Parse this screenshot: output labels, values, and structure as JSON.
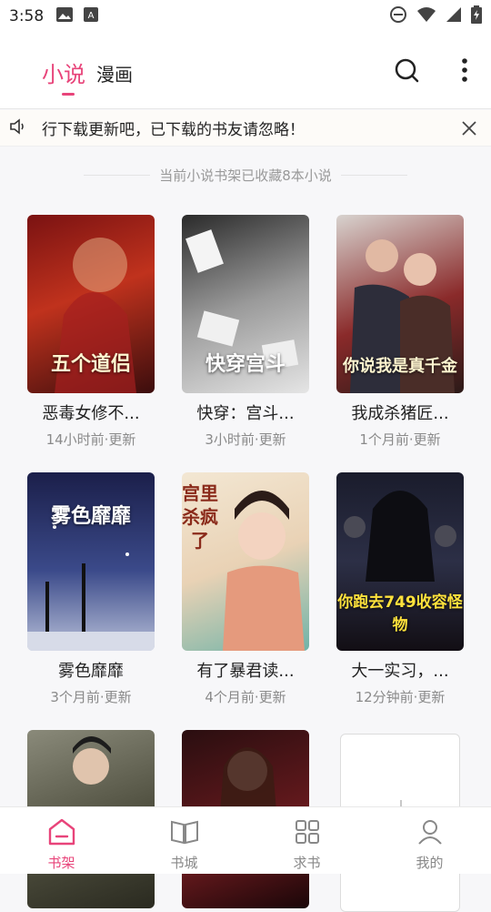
{
  "status_bar": {
    "time": "3:58"
  },
  "header": {
    "tabs": [
      {
        "label": "小说",
        "active": true
      },
      {
        "label": "漫画",
        "active": false
      }
    ],
    "accent_color": "#e8447a",
    "icons": [
      "search-icon",
      "more-vertical-icon"
    ]
  },
  "notice": {
    "icon": "speaker-icon",
    "text": "行下载更新吧，已下载的书友请忽略！"
  },
  "shelf_summary": "当前小说书架已收藏8本小说",
  "books": [
    {
      "title": "恶毒女修不...",
      "updated": "14小时前·更新",
      "cover_text": "五个道侣"
    },
    {
      "title": "快穿：宫斗...",
      "updated": "3小时前·更新",
      "cover_text": "快穿宫斗"
    },
    {
      "title": "我成杀猪匠...",
      "updated": "1个月前·更新",
      "cover_text": "你说我是真千金"
    },
    {
      "title": "雾色靡靡",
      "updated": "3个月前·更新",
      "cover_text": "雾色靡靡"
    },
    {
      "title": "有了暴君读...",
      "updated": "4个月前·更新",
      "cover_text": "宫里杀疯了"
    },
    {
      "title": "大一实习，...",
      "updated": "12分钟前·更新",
      "cover_text": "你跑去749收容怪物"
    },
    {
      "title": "",
      "updated": ""
    },
    {
      "title": "",
      "updated": ""
    }
  ],
  "bottom_nav": [
    {
      "label": "书架",
      "icon": "bookshelf-icon",
      "active": true
    },
    {
      "label": "书城",
      "icon": "book-open-icon",
      "active": false
    },
    {
      "label": "求书",
      "icon": "grid-icon",
      "active": false
    },
    {
      "label": "我的",
      "icon": "user-icon",
      "active": false
    }
  ]
}
